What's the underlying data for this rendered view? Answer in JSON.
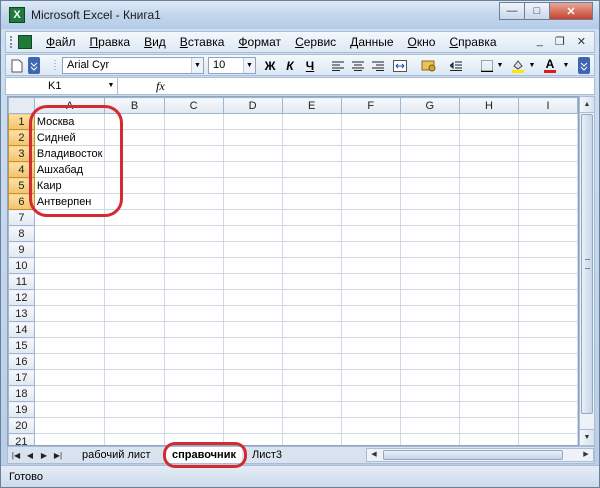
{
  "window": {
    "title": "Microsoft Excel - Книга1",
    "app_icon_letter": "X",
    "buttons": {
      "minimize": "—",
      "maximize": "□",
      "close": "✕"
    }
  },
  "menubar": {
    "items": [
      "Файл",
      "Правка",
      "Вид",
      "Вставка",
      "Формат",
      "Сервис",
      "Данные",
      "Окно",
      "Справка"
    ],
    "doc_buttons": {
      "minimize": "_",
      "restore": "❐",
      "close": "✕"
    }
  },
  "toolbar": {
    "font_name": "Arial Cyr",
    "font_size": "10",
    "bold": "Ж",
    "italic": "К",
    "underline": "Ч",
    "font_color_glyph": "A"
  },
  "formula_bar": {
    "name_box": "K1",
    "fx": "fx",
    "formula": ""
  },
  "grid": {
    "columns": [
      "A",
      "B",
      "C",
      "D",
      "E",
      "F",
      "G",
      "H",
      "I"
    ],
    "rows": [
      "1",
      "2",
      "3",
      "4",
      "5",
      "6",
      "7",
      "8",
      "9",
      "10",
      "11",
      "12",
      "13",
      "14",
      "15",
      "16",
      "17",
      "18",
      "19",
      "20",
      "21"
    ],
    "colA_values": [
      "Москва",
      "Сидней",
      "Владивосток",
      "Ашхабад",
      "Каир",
      "Антверпен"
    ]
  },
  "sheet_tabs": {
    "tabs": [
      "рабочий лист",
      "справочник",
      "Лист3"
    ],
    "active": "справочник"
  },
  "status": {
    "text": "Готово"
  },
  "colors": {
    "annotation": "#d42a32",
    "selected_header": "#f4c36b"
  }
}
